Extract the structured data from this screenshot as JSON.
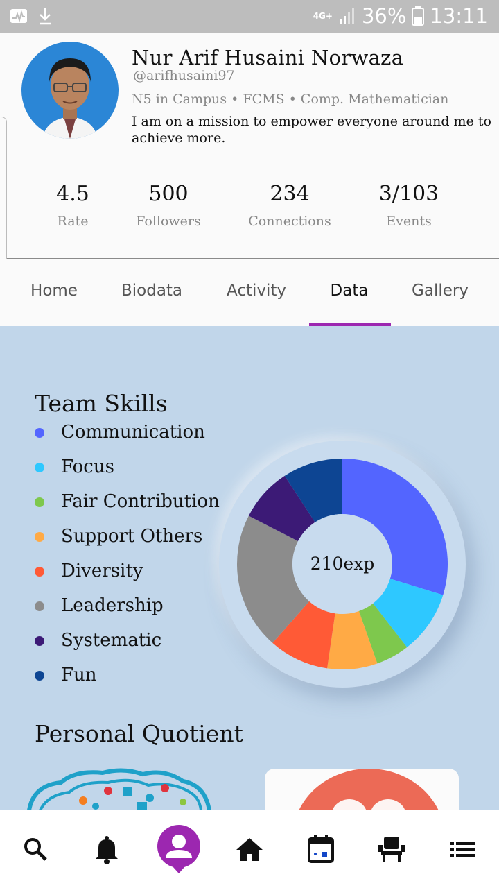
{
  "status_bar": {
    "network": "4G+",
    "battery": "36%",
    "time": "13:11"
  },
  "profile": {
    "name": "Nur Arif Husaini Norwaza",
    "handle": "@arifhusaini97",
    "meta": "N5 in Campus • FCMS • Comp. Mathematician",
    "bio": "I am on a mission to empower everyone around me to achieve more.",
    "stats": [
      {
        "value": "4.5",
        "label": "Rate"
      },
      {
        "value": "500",
        "label": "Followers"
      },
      {
        "value": "234",
        "label": "Connections"
      },
      {
        "value": "3/103",
        "label": "Events"
      }
    ]
  },
  "tabs": [
    {
      "label": "Home"
    },
    {
      "label": "Biodata"
    },
    {
      "label": "Activity"
    },
    {
      "label": "Data",
      "active": true
    },
    {
      "label": "Gallery"
    }
  ],
  "data_section": {
    "team_skills_title": "Team Skills",
    "personal_quotient_title": "Personal Quotient",
    "center_label": "210exp"
  },
  "chart_data": {
    "type": "pie",
    "categories": [
      "Communication",
      "Focus",
      "Fair Contribution",
      "Support Others",
      "Diversity",
      "Leadership",
      "Systematic",
      "Fun"
    ],
    "values": [
      58,
      19,
      10,
      15,
      18,
      41,
      16,
      18
    ],
    "colors": [
      "#5365ff",
      "#2ec8ff",
      "#7ec84d",
      "#ffaa45",
      "#ff5a36",
      "#8c8c8c",
      "#3c1a76",
      "#0d4593"
    ],
    "title": "Team Skills",
    "center_text": "210exp",
    "legend": "left"
  },
  "bottom_nav": {
    "items": [
      {
        "icon": "search-icon"
      },
      {
        "icon": "bell-icon"
      },
      {
        "icon": "profile-icon",
        "active": true
      },
      {
        "icon": "home-icon"
      },
      {
        "icon": "calendar-icon"
      },
      {
        "icon": "seat-icon"
      },
      {
        "icon": "list-icon"
      }
    ],
    "accent": "#9c27b0"
  }
}
